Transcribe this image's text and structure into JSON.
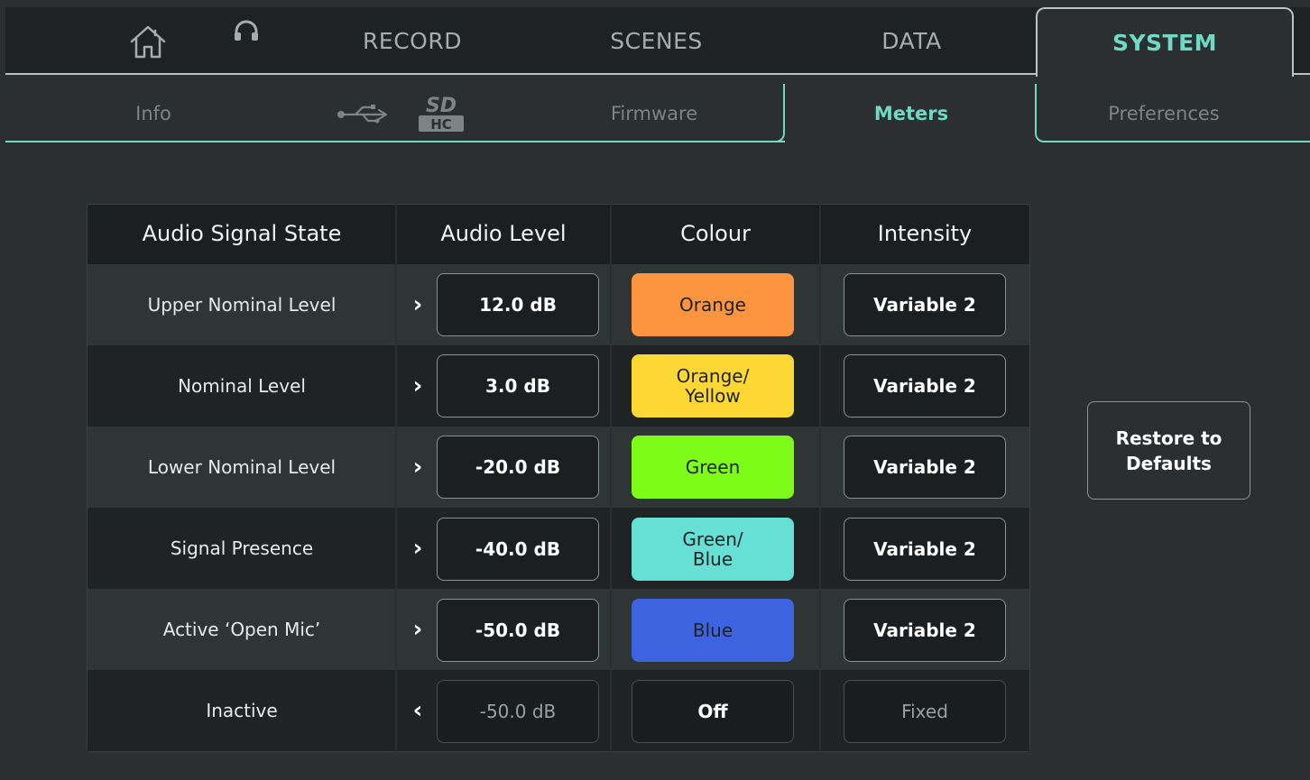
{
  "top_tabs": [
    "RECORD",
    "SCENES",
    "DATA",
    "SYSTEM"
  ],
  "sub_tabs": {
    "info": "Info",
    "firmware": "Firmware",
    "meters": "Meters",
    "preferences": "Preferences"
  },
  "sd_icon_text": "SD HC",
  "table": {
    "headers": [
      "Audio Signal State",
      "Audio Level",
      "Colour",
      "Intensity"
    ],
    "rows": [
      {
        "state": "Upper Nominal Level",
        "dir": "›",
        "level": "12.0 dB",
        "colour_lines": [
          "Orange"
        ],
        "intensity": "Variable 2"
      },
      {
        "state": "Nominal Level",
        "dir": "›",
        "level": "3.0 dB",
        "colour_lines": [
          "Orange/",
          "Yellow"
        ],
        "intensity": "Variable 2"
      },
      {
        "state": "Lower Nominal Level",
        "dir": "›",
        "level": "-20.0 dB",
        "colour_lines": [
          "Green"
        ],
        "intensity": "Variable 2"
      },
      {
        "state": "Signal Presence",
        "dir": "›",
        "level": "-40.0 dB",
        "colour_lines": [
          "Green/",
          "Blue"
        ],
        "intensity": "Variable 2"
      },
      {
        "state": "Active ‘Open Mic’",
        "dir": "›",
        "level": "-50.0 dB",
        "colour_lines": [
          "Blue"
        ],
        "intensity": "Variable 2"
      },
      {
        "state": "Inactive",
        "dir": "‹",
        "level": "-50.0 dB",
        "colour_lines": [
          "Off"
        ],
        "intensity": "Fixed"
      }
    ]
  },
  "colors": {
    "accent": "#6fd9c5",
    "orange": "#fd9540",
    "orange_yellow": "#fdd835",
    "green": "#7efc19",
    "green_blue": "#66dfd4",
    "blue": "#3d63e0"
  },
  "restore": {
    "line1": "Restore to",
    "line2": "Defaults"
  }
}
